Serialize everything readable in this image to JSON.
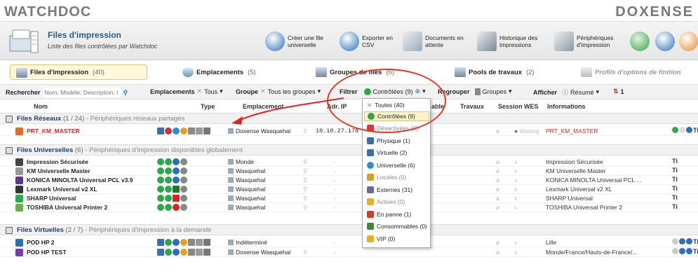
{
  "brand": {
    "left": "WATCHDOC",
    "right": "DOXENSE"
  },
  "header": {
    "title": "Files d'impression",
    "subtitle": "Liste des files contrôlées par Watchdoc"
  },
  "toolbar": [
    {
      "label": "Créer une file universelle",
      "color": "#2a6fb8"
    },
    {
      "label": "Exporter en CSV",
      "color": "#1f6fb5"
    },
    {
      "label": "Documents en attente",
      "color": "#6b8fb2"
    },
    {
      "label": "Historique des impressions",
      "color": "#5c6c8a"
    },
    {
      "label": "Périphériques d'impression",
      "color": "#7a8a9a"
    }
  ],
  "tabs": [
    {
      "label": "Files d'impression",
      "count": "(40)",
      "active": true
    },
    {
      "label": "Emplacements",
      "count": "(5)"
    },
    {
      "label": "Groupes de files",
      "count": "(6)"
    },
    {
      "label": "Pools de travaux",
      "count": "(2)"
    },
    {
      "label": "Profils d'options de finition",
      "count": ""
    }
  ],
  "filterbar": {
    "search_label": "Rechercher",
    "search_placeholder": "Nom, Modèle, Description, I",
    "emplacements_label": "Emplacements",
    "emplacements_value": "Tous",
    "groupe_label": "Groupe",
    "groupe_value": "Tous les groupes",
    "filtrer_label": "Filtrer",
    "filtrer_value": "Contrôlées (9)",
    "regrouper_label": "Regrouper",
    "regrouper_value": "Groupes",
    "afficher_label": "Afficher",
    "afficher_value": "Résumé",
    "count_value": "1"
  },
  "columns": {
    "nom": "Nom",
    "type": "Type",
    "emplacement": "Emplacement",
    "adr_ip": "Adr. IP",
    "able": "able",
    "travaux": "Travaux",
    "session_wes": "Session WES",
    "informations": "Informations"
  },
  "sections": [
    {
      "title": "Files Réseaux",
      "count": "(1 / 24)",
      "desc": "Périphériques réseaux partagés"
    },
    {
      "title": "Files Universelles",
      "count": "(6)",
      "desc": "Périphériques d'impression disponibles globalement"
    },
    {
      "title": "Files Virtuelles",
      "count": "(2 / 7)",
      "desc": "Périphériques d'impression à la demande"
    }
  ],
  "rows_reseaux": [
    {
      "name": "PRT_KM_MASTER",
      "location": "Doxense Wasquehal",
      "ip": "10.10.27.178",
      "slash": "ø",
      "wes": "Waiting",
      "info": "PRT_KM_MASTER"
    }
  ],
  "rows_universelles": [
    {
      "name": "Impression Sécurisée",
      "location": "Monde",
      "dash": "-",
      "slash": "ø",
      "wes": "x",
      "info": "Impression Sécurisée"
    },
    {
      "name": "KM Universelle Master",
      "location": "Wasquehal",
      "dash": "-",
      "slash": "ø",
      "wes": "x",
      "info": "KM Universelle Master"
    },
    {
      "name": "KONICA MINOLTA Universal PCL v3.9",
      "location": "Wasquehal",
      "dash": "-",
      "slash": "ø",
      "wes": "x",
      "info": "KONICA MINOLTA Universal PCL ..."
    },
    {
      "name": "Lexmark Universal v2 XL",
      "location": "Wasquehal",
      "dash": "-",
      "slash": "ø",
      "wes": "x",
      "info": "Lexmark Universal v2 XL"
    },
    {
      "name": "SHARP Universal",
      "location": "Wasquehal",
      "dash": "-",
      "slash": "ø",
      "wes": "x",
      "info": "SHARP Universal"
    },
    {
      "name": "TOSHIBA Universal Printer 2",
      "location": "Wasquehal",
      "dash": "-",
      "slash": "ø",
      "wes": "x",
      "info": "TOSHIBA Universal Printer 2"
    }
  ],
  "rows_virtuelles": [
    {
      "name": "POD HP 2",
      "location": "Indéterminé",
      "dash": "-",
      "slash": "ø",
      "wes": "x",
      "info": "Lille"
    },
    {
      "name": "POD HP TEST",
      "location": "Doxense Wasquehal",
      "dash": "-",
      "slash": "ø",
      "wes": "x",
      "info": "Monde/France/Hauts-de-France/..."
    }
  ],
  "dropdown": [
    {
      "label": "Toutes (40)",
      "color": "#888"
    },
    {
      "label": "Contrôlées (9)",
      "color": "#2aa84a",
      "selected": true
    },
    {
      "label": "Désactivées (0)",
      "color": "#d33",
      "muted": true
    },
    {
      "label": "Physique (1)",
      "color": "#3a6ea8"
    },
    {
      "label": "Virtuelle (2)",
      "color": "#3a6ea8"
    },
    {
      "label": "Universelle (6)",
      "color": "#2a8fd8"
    },
    {
      "label": "Locales (0)",
      "color": "#d8a020",
      "muted": true
    },
    {
      "label": "Externes (31)",
      "color": "#6a6a9a"
    },
    {
      "label": "Actives (0)",
      "color": "#e8b020",
      "muted": true
    },
    {
      "label": "En panne (1)",
      "color": "#d04020"
    },
    {
      "label": "Consommables (0)",
      "color": "#3a8a3a"
    },
    {
      "label": "VIP (0)",
      "color": "#e8b020"
    }
  ],
  "action_label": "Ti",
  "colors": {
    "accent": "#2a5a8a",
    "annotation": "#e32222",
    "selected": "#fdf2c8"
  }
}
